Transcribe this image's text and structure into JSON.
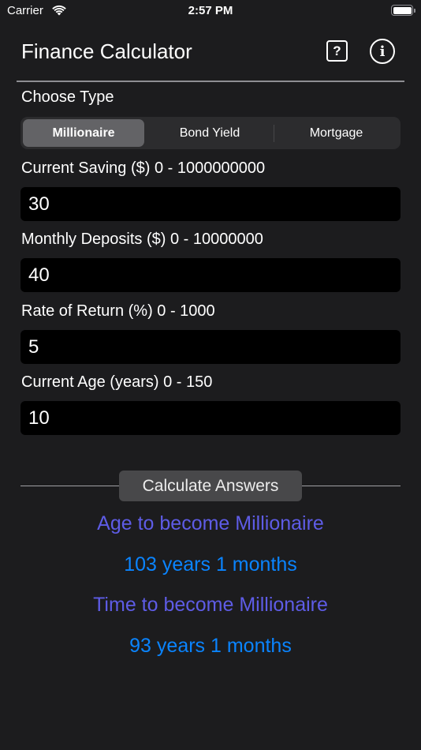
{
  "status_bar": {
    "carrier": "Carrier",
    "time": "2:57 PM",
    "wifi_icon": "wifi-icon",
    "battery_icon": "battery-full-icon"
  },
  "header": {
    "title": "Finance Calculator",
    "help_icon": "?",
    "info_icon": "i"
  },
  "type_selector": {
    "label": "Choose Type",
    "options": [
      "Millionaire",
      "Bond Yield",
      "Mortgage"
    ],
    "selected": "Millionaire"
  },
  "fields": [
    {
      "label": "Current Saving ($) 0 - 1000000000",
      "value": "30"
    },
    {
      "label": "Monthly Deposits ($) 0 - 10000000",
      "value": "40"
    },
    {
      "label": "Rate of Return (%) 0 - 1000",
      "value": "5"
    },
    {
      "label": "Current Age (years) 0 - 150",
      "value": "10"
    }
  ],
  "calculate_button": "Calculate Answers",
  "results": {
    "age_heading": "Age to become Millionaire",
    "age_value": "103 years 1 months",
    "time_heading": "Time to become Millionaire",
    "time_value": "93 years 1 months"
  },
  "colors": {
    "background": "#1c1c1e",
    "heading": "#5e5ce6",
    "value": "#0a84ff"
  }
}
